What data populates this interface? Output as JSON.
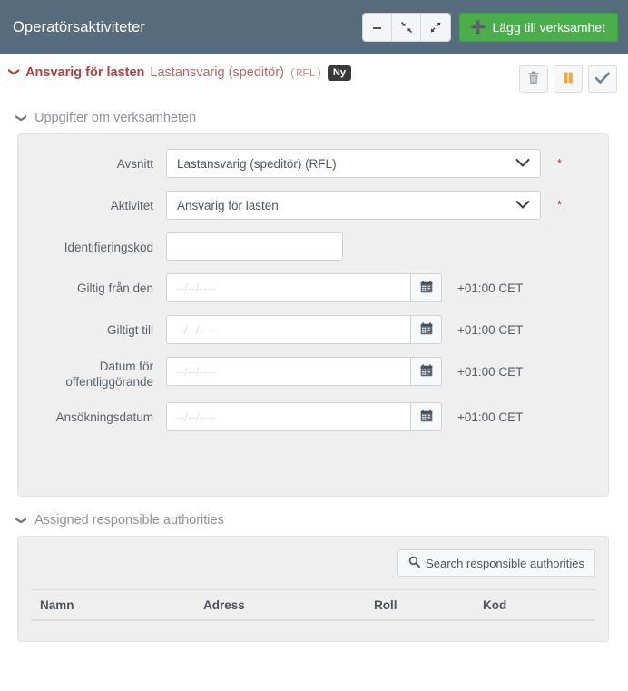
{
  "window": {
    "title": "Operatörsaktiviteter",
    "buttons": {
      "minimize": "minimize",
      "collapse": "collapse",
      "expand": "expand",
      "add_label": "Lägg till verksamhet",
      "add_icon": "plus-icon"
    }
  },
  "activity": {
    "caret": "⌄",
    "primary": "Ansvarig för lasten",
    "secondary": "Lastansvarig (speditör)",
    "code": "(RFL)",
    "status_badge": "Ny",
    "actions": {
      "delete": "trash-icon",
      "suspend": "pause-icon",
      "approve": "check-icon"
    }
  },
  "sections": {
    "details": {
      "title": "Uppgifter om verksamheten",
      "fields": {
        "avsnitt": {
          "label": "Avsnitt",
          "value": "Lastansvarig (speditör) (RFL)",
          "required": "*"
        },
        "aktivitet": {
          "label": "Aktivitet",
          "value": "Ansvarig för lasten",
          "required": "*"
        },
        "identifieringskod": {
          "label": "Identifieringskod",
          "value": "",
          "placeholder": ""
        },
        "giltig_fran": {
          "label": "Giltig från den",
          "value": "",
          "placeholder": "--/--/----",
          "timezone": "+01:00 CET"
        },
        "giltigt_till": {
          "label": "Giltigt till",
          "value": "",
          "placeholder": "--/--/----",
          "timezone": "+01:00 CET"
        },
        "datum_offentliggorande": {
          "label_line1": "Datum för",
          "label_line2": "offentliggörande",
          "value": "",
          "placeholder": "--/--/----",
          "timezone": "+01:00 CET"
        },
        "ansokningsdatum": {
          "label": "Ansökningsdatum",
          "value": "",
          "placeholder": "--/--/----",
          "timezone": "+01:00 CET"
        }
      }
    },
    "authorities": {
      "title": "Assigned responsible authorities",
      "search_button": "Search responsible authorities",
      "search_icon": "search-icon",
      "columns": [
        "Namn",
        "Adress",
        "Roll",
        "Kod"
      ],
      "rows": []
    }
  },
  "colors": {
    "header_bar": "#566b7b",
    "add_button": "#4aae4c",
    "accent_red": "#a94442",
    "badge_dark": "#3a3a3a",
    "panel_bg": "#efefef",
    "pause_orange": "#efa93c",
    "check_blue": "#6f8494"
  }
}
